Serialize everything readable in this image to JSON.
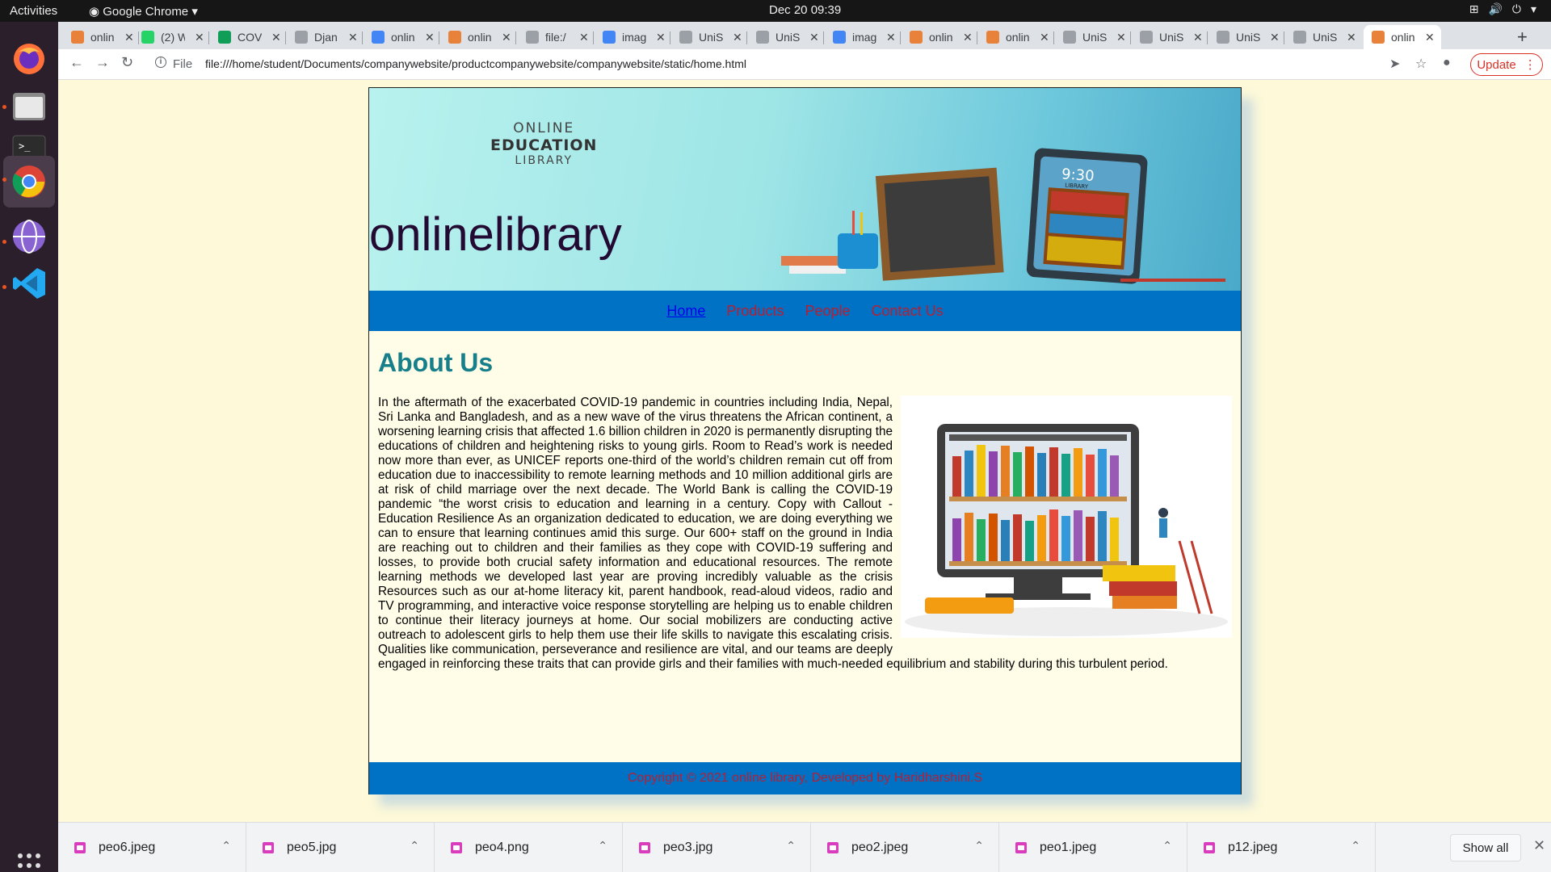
{
  "os": {
    "activities": "Activities",
    "app_name": "Google Chrome",
    "clock": "Dec 20  09:39"
  },
  "tabs": [
    {
      "title": "onlin",
      "favicon_color": "#e8823a"
    },
    {
      "title": "(2) W",
      "favicon_color": "#25d366"
    },
    {
      "title": "COV",
      "favicon_color": "#0f9d58"
    },
    {
      "title": "Djan",
      "favicon_color": "#9aa0a6"
    },
    {
      "title": "onlin",
      "favicon_color": "#4285f4"
    },
    {
      "title": "onlin",
      "favicon_color": "#e8823a"
    },
    {
      "title": "file:/",
      "favicon_color": "#9aa0a6"
    },
    {
      "title": "imag",
      "favicon_color": "#4285f4"
    },
    {
      "title": "UniS",
      "favicon_color": "#9aa0a6"
    },
    {
      "title": "UniS",
      "favicon_color": "#9aa0a6"
    },
    {
      "title": "imag",
      "favicon_color": "#4285f4"
    },
    {
      "title": "onlin",
      "favicon_color": "#e8823a"
    },
    {
      "title": "onlin",
      "favicon_color": "#e8823a"
    },
    {
      "title": "UniS",
      "favicon_color": "#9aa0a6"
    },
    {
      "title": "UniS",
      "favicon_color": "#9aa0a6"
    },
    {
      "title": "UniS",
      "favicon_color": "#9aa0a6"
    },
    {
      "title": "UniS",
      "favicon_color": "#9aa0a6"
    },
    {
      "title": "onlin",
      "favicon_color": "#e8823a"
    }
  ],
  "address": {
    "scheme_label": "File",
    "url": "file:///home/student/Documents/companywebsite/productcompanywebsite/companywebsite/static/home.html",
    "update_label": "Update"
  },
  "site": {
    "logo_line1": "ONLINE",
    "logo_line2": "EDUCATION",
    "logo_line3": "LIBRARY",
    "banner_clock": "9:30",
    "banner_shelf_label": "LIBRARY",
    "title": "onlinelibrary",
    "nav": [
      "Home",
      "Products",
      "People",
      "Contact Us"
    ],
    "about_heading": "About Us",
    "about_text": "In the aftermath of the exacerbated COVID-19 pandemic in countries including India, Nepal, Sri Lanka and Bangladesh, and as a new wave of the virus threatens the African continent, a worsening learning crisis that affected 1.6 billion children in 2020 is permanently disrupting the educations of children and heightening risks to young girls. Room to Read’s work is needed now more than ever, as UNICEF reports one-third of the world’s children remain cut off from education due to inaccessibility to remote learning methods and 10 million additional girls are at risk of child marriage over the next decade. The World Bank is calling the COVID-19 pandemic “the worst crisis to education and learning in a century. Copy with Callout - Education Resilience As an organization dedicated to education, we are doing everything we can to ensure that learning continues amid this surge. Our 600+ staff on the ground in India are reaching out to children and their families as they cope with COVID-19 suffering and losses, to provide both crucial safety information and educational resources. The remote learning methods we developed last year are proving incredibly valuable as the crisis Resources such as our at-home literacy kit, parent handbook, read-aloud videos, radio and TV programming, and interactive voice response storytelling are helping us to enable children to continue their literacy journeys at home. Our social mobilizers are conducting active outreach to adolescent girls to help them use their life skills to navigate this escalating crisis. Qualities like communication, perseverance and resilience are vital, and our teams are deeply engaged in reinforcing these traits that can provide girls and their families with much-needed equilibrium and stability during this turbulent period.",
    "footer": "Copyright © 2021 online library, Developed by Haridharshini.S"
  },
  "downloads": [
    "peo6.jpeg",
    "peo5.jpg",
    "peo4.png",
    "peo3.jpg",
    "peo2.jpeg",
    "peo1.jpeg",
    "p12.jpeg"
  ],
  "show_all_label": "Show all",
  "colors": {
    "nav_bar": "#0072c6",
    "nav_link": "#b81e32",
    "heading": "#167f8a",
    "page_bg": "#fdf9d9"
  }
}
